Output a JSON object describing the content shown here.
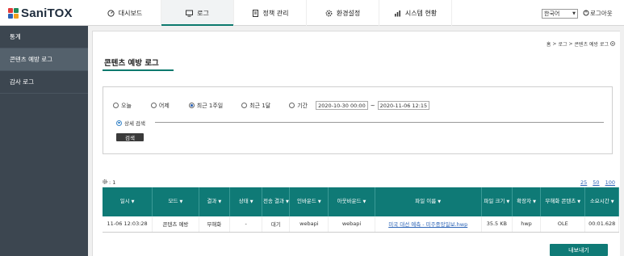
{
  "brand": {
    "name_main": "Sani",
    "name_accent": "TOX"
  },
  "nav": [
    {
      "label": "대시보드",
      "icon": "dashboard-icon",
      "active": false
    },
    {
      "label": "로그",
      "icon": "monitor-icon",
      "active": true
    },
    {
      "label": "정책 관리",
      "icon": "document-icon",
      "active": false
    },
    {
      "label": "환경설정",
      "icon": "gear-icon",
      "active": false
    },
    {
      "label": "시스템 현황",
      "icon": "bar-chart-icon",
      "active": false
    }
  ],
  "header": {
    "language": "한국어",
    "logout": "로그아웃"
  },
  "sidebar": {
    "items": [
      {
        "label": "통계",
        "active": false
      },
      {
        "label": "콘텐츠 예방 로그",
        "active": true
      },
      {
        "label": "감사 로그",
        "active": false
      }
    ]
  },
  "breadcrumb": {
    "home": "홈",
    "sep": ">",
    "level1": "로그",
    "level2": "콘텐츠 예방 로그"
  },
  "page": {
    "title": "콘텐츠 예방 로그"
  },
  "filter": {
    "options": [
      "오늘",
      "어제",
      "최근 1주일",
      "최근 1달",
      "기간"
    ],
    "selected_index": 2,
    "date_from": "2020-10-30 00:00",
    "date_sep": "~",
    "date_to": "2020-11-06 12:15",
    "detail_label": "상세 검색",
    "search_button": "검색"
  },
  "results": {
    "count_label": ": 1",
    "page_sizes": [
      "25",
      "50",
      "100"
    ],
    "columns": [
      "일시",
      "모드",
      "결과",
      "상태",
      "전송 결과",
      "인바운드",
      "아웃바운드",
      "파일 이름",
      "파일 크기",
      "확장자",
      "무해화 콘텐츠",
      "소요시간"
    ],
    "rows": [
      [
        "11-06 12:03:28",
        "콘텐츠 예방",
        "무해화",
        "-",
        "대기",
        "webapi",
        "webapi",
        "미국 대선 예측 - 미주중앙일보.hwp",
        "35.5 KB",
        "hwp",
        "OLE",
        "00:01.628"
      ]
    ]
  },
  "export_button": "내보내기",
  "colors": {
    "accent": "#0f7a76",
    "sidebar": "#3c4650",
    "link": "#2b63b6"
  }
}
